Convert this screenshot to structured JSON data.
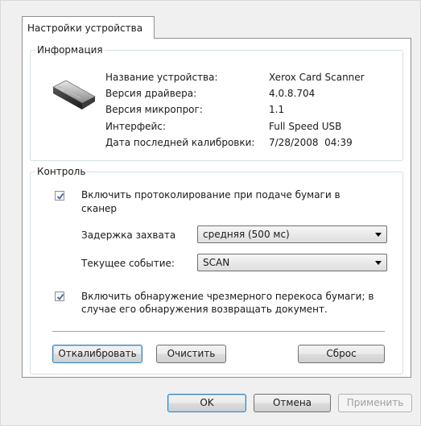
{
  "tab": {
    "label": "Настройки устройства"
  },
  "info": {
    "title": "Информация",
    "rows": [
      {
        "label": "Название устройства:",
        "value": "Xerox Card Scanner"
      },
      {
        "label": "Версия драйвера:",
        "value": "4.0.8.704"
      },
      {
        "label": "Версия микропрог:",
        "value": "1.1"
      },
      {
        "label": "Интерфейс:",
        "value": "Full Speed USB"
      },
      {
        "label": "Дата последней калибровки:",
        "value": "7/28/2008  04:39"
      }
    ]
  },
  "control": {
    "title": "Контроль",
    "logging_checkbox": {
      "checked": true,
      "line1": "Включить протоколирование при подаче бумаги в",
      "line2": "сканер"
    },
    "capture_delay": {
      "label": "Задержка захвата",
      "value": "средняя (500 мс)"
    },
    "current_event": {
      "label": "Текущее событие:",
      "value": "SCAN"
    },
    "skew_checkbox": {
      "checked": true,
      "line1": "Включить обнаружение чрезмерного перекоса бумаги; в",
      "line2": "случае его обнаружения возвращать документ."
    },
    "buttons": {
      "calibrate": "Откалибровать",
      "clear": "Очистить",
      "reset": "Сброс"
    }
  },
  "dialog_buttons": {
    "ok": "OK",
    "cancel": "Отмена",
    "apply": "Применить"
  },
  "colors": {
    "accent": "#3c7fb1",
    "checkmark": "#4a5f97",
    "panel_border": "#8e8f8f"
  },
  "icons": {
    "device": "card-scanner-icon",
    "check": "checkmark-icon",
    "dropdown": "chevron-down-icon"
  }
}
